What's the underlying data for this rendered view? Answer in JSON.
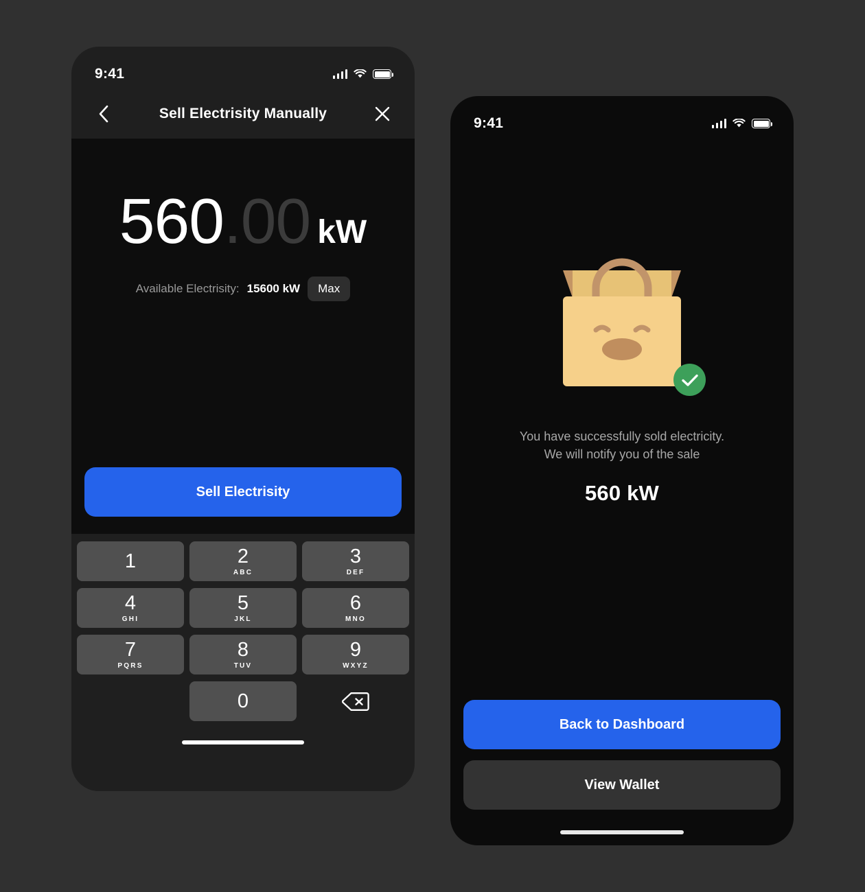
{
  "phone_sell": {
    "status_bar": {
      "time": "9:41",
      "icons": [
        "cellular-signal-icon",
        "wifi-icon",
        "battery-icon"
      ]
    },
    "nav": {
      "back_icon": "chevron-left-icon",
      "title": "Sell Electrisity Manually",
      "close_icon": "close-icon"
    },
    "amount": {
      "integer": "560",
      "decimal": ".00",
      "unit": "kW"
    },
    "available": {
      "label": "Available Electrisity:",
      "value": "15600 kW",
      "max_button": "Max"
    },
    "cta": "Sell Electrisity",
    "keypad": [
      [
        {
          "digit": "1",
          "letters": ""
        },
        {
          "digit": "2",
          "letters": "ABC"
        },
        {
          "digit": "3",
          "letters": "DEF"
        }
      ],
      [
        {
          "digit": "4",
          "letters": "GHI"
        },
        {
          "digit": "5",
          "letters": "JKL"
        },
        {
          "digit": "6",
          "letters": "MNO"
        }
      ],
      [
        {
          "digit": "7",
          "letters": "PQRS"
        },
        {
          "digit": "8",
          "letters": "TUV"
        },
        {
          "digit": "9",
          "letters": "WXYZ"
        }
      ],
      [
        {
          "digit": "",
          "letters": ""
        },
        {
          "digit": "0",
          "letters": ""
        },
        {
          "digit": "backspace-icon",
          "letters": ""
        }
      ]
    ]
  },
  "phone_success": {
    "status_bar": {
      "time": "9:41",
      "icons": [
        "cellular-signal-icon",
        "wifi-icon",
        "battery-icon"
      ]
    },
    "illustration": {
      "name": "shopping-bag-illustration",
      "badge": "check-circle-icon"
    },
    "message_line1": "You have successfully sold electricity.",
    "message_line2": "We will notify you of the sale",
    "amount": "560 kW",
    "primary_button": "Back to Dashboard",
    "secondary_button": "View Wallet"
  },
  "colors": {
    "page_background": "#303030",
    "phone_chrome": "#1f1f1f",
    "screen_background": "#0d0d0d",
    "accent_blue": "#2563eb",
    "key_gray": "#505050",
    "secondary_gray": "#333333",
    "success_green": "#3da05a",
    "bag_body": "#f6d08a",
    "bag_top": "#e7c276",
    "bag_gusset": "#c49564",
    "bag_handle": "#c1946a",
    "muted_text": "#9a9a9a",
    "dim_decimal": "#3b3b3b"
  }
}
